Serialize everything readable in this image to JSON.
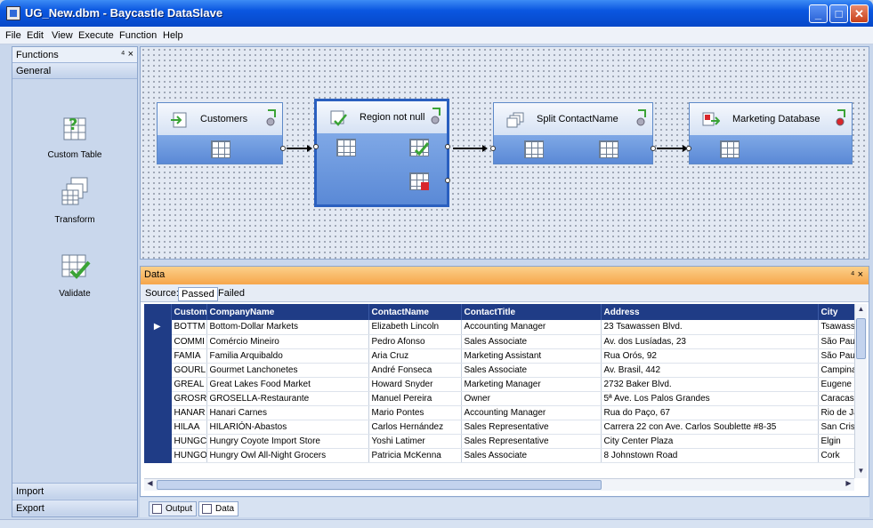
{
  "window": {
    "title": "UG_New.dbm - Baycastle DataSlave",
    "buttons": {
      "minimize": "_",
      "maximize": "□",
      "close": "✕"
    }
  },
  "menu": [
    "File",
    "Edit",
    "View",
    "Execute",
    "Function",
    "Help"
  ],
  "sidebar": {
    "title": "Functions",
    "pin": "⁴ ×",
    "group": "General",
    "tools": [
      {
        "label": "Custom Table",
        "icon": "custom-table-icon"
      },
      {
        "label": "Transform",
        "icon": "transform-icon"
      },
      {
        "label": "Validate",
        "icon": "validate-icon"
      }
    ],
    "bottom": [
      "Import",
      "Export"
    ]
  },
  "workflow": {
    "nodes": [
      {
        "label": "Customers",
        "icon": "import-arrow-icon"
      },
      {
        "label": "Region not null",
        "icon": "validate-icon"
      },
      {
        "label": "Split ContactName",
        "icon": "transform-icon"
      },
      {
        "label": "Marketing Database",
        "icon": "export-icon"
      }
    ]
  },
  "data_panel": {
    "title": "Data",
    "pin": "⁴ ×",
    "source_label": "Source:",
    "tabs": [
      "Passed",
      "Failed"
    ],
    "active_tab": "Passed",
    "columns": [
      "Custom",
      "CompanyName",
      "ContactName",
      "ContactTitle",
      "Address",
      "City"
    ],
    "rows": [
      [
        "BOTTM",
        "Bottom-Dollar Markets",
        "Elizabeth Lincoln",
        "Accounting Manager",
        "23 Tsawassen Blvd.",
        "Tsawass"
      ],
      [
        "COMMI",
        "Comércio Mineiro",
        "Pedro Afonso",
        "Sales Associate",
        "Av. dos Lusíadas, 23",
        "São Paulo"
      ],
      [
        "FAMIA",
        "Familia Arquibaldo",
        "Aria Cruz",
        "Marketing Assistant",
        "Rua Orós, 92",
        "São Paulo"
      ],
      [
        "GOURL",
        "Gourmet Lanchonetes",
        "André Fonseca",
        "Sales Associate",
        "Av. Brasil, 442",
        "Campinas"
      ],
      [
        "GREAL",
        "Great Lakes Food Market",
        "Howard Snyder",
        "Marketing Manager",
        "2732 Baker Blvd.",
        "Eugene"
      ],
      [
        "GROSR",
        "GROSELLA-Restaurante",
        "Manuel Pereira",
        "Owner",
        "5ª Ave. Los Palos Grandes",
        "Caracas"
      ],
      [
        "HANAR",
        "Hanari Carnes",
        "Mario Pontes",
        "Accounting Manager",
        "Rua do Paço, 67",
        "Rio de Ja"
      ],
      [
        "HILAA",
        "HILARIÓN-Abastos",
        "Carlos Hernández",
        "Sales Representative",
        "Carrera 22 con Ave. Carlos Soublette #8-35",
        "San Crist"
      ],
      [
        "HUNGC",
        "Hungry Coyote Import Store",
        "Yoshi Latimer",
        "Sales Representative",
        "City Center Plaza",
        "Elgin"
      ],
      [
        "HUNGO",
        "Hungry Owl All-Night Grocers",
        "Patricia McKenna",
        "Sales Associate",
        "8 Johnstown Road",
        "Cork"
      ]
    ],
    "current_row_marker": "▶"
  },
  "bottom_tabs": [
    "Output",
    "Data"
  ],
  "active_bottom_tab": "Data"
}
